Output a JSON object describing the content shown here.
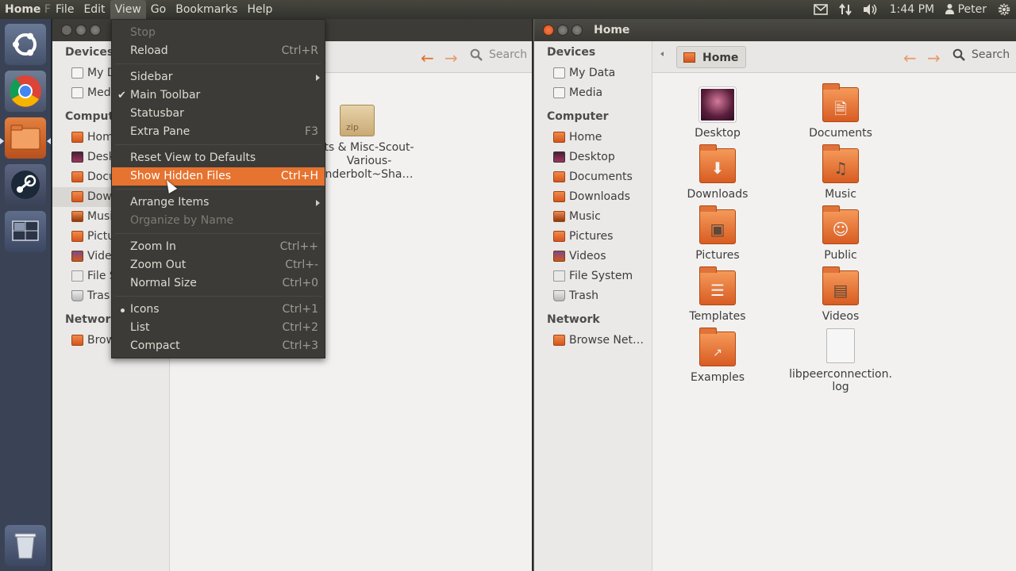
{
  "top_panel": {
    "app_title": "Home",
    "app_title_suffix": " F",
    "menus": [
      "File",
      "Edit",
      "View",
      "Go",
      "Bookmarks",
      "Help"
    ],
    "clock": "1:44 PM",
    "user": "Peter"
  },
  "launcher": {
    "items": [
      "Ubuntu",
      "Chromium",
      "Files",
      "Steam",
      "Workspace Switcher",
      "Trash"
    ]
  },
  "view_menu": {
    "items": [
      {
        "label": "Stop",
        "accel": ""
      },
      {
        "label": "Reload",
        "accel": "Ctrl+R"
      },
      {
        "label": "Sidebar",
        "accel": ""
      },
      {
        "label": "Main Toolbar",
        "accel": ""
      },
      {
        "label": "Statusbar",
        "accel": ""
      },
      {
        "label": "Extra Pane",
        "accel": "F3"
      },
      {
        "label": "Reset View to Defaults",
        "accel": ""
      },
      {
        "label": "Show Hidden Files",
        "accel": "Ctrl+H"
      },
      {
        "label": "Arrange Items",
        "accel": ""
      },
      {
        "label": "Organize by Name",
        "accel": ""
      },
      {
        "label": "Zoom In",
        "accel": "Ctrl++"
      },
      {
        "label": "Zoom Out",
        "accel": "Ctrl+-"
      },
      {
        "label": "Normal Size",
        "accel": "Ctrl+0"
      },
      {
        "label": "Icons",
        "accel": "Ctrl+1"
      },
      {
        "label": "List",
        "accel": "Ctrl+2"
      },
      {
        "label": "Compact",
        "accel": "Ctrl+3"
      }
    ]
  },
  "left_window": {
    "sidebar": {
      "devices_heading": "Devices",
      "devices": [
        "My D",
        "Medi"
      ],
      "computer_heading": "Comput",
      "computer": [
        "Home",
        "Desk",
        "Docu",
        "Dow",
        "Musi",
        "Pictu",
        "Vide",
        "File S",
        "Tras"
      ],
      "network_heading": "Network",
      "network": [
        "Brow"
      ]
    },
    "search_label": "Search",
    "zip_label": "zip",
    "zip_name": [
      "ts & Misc-Scout-",
      "Various-",
      "nderbolt~Sha…"
    ]
  },
  "right_window": {
    "title": "Home",
    "breadcrumb": "Home",
    "search_label": "Search",
    "sidebar": {
      "devices_heading": "Devices",
      "devices": [
        "My Data",
        "Media"
      ],
      "computer_heading": "Computer",
      "computer": [
        "Home",
        "Desktop",
        "Documents",
        "Downloads",
        "Music",
        "Pictures",
        "Videos",
        "File System",
        "Trash"
      ],
      "network_heading": "Network",
      "network": [
        "Browse Net…"
      ]
    },
    "files": [
      {
        "name": "Desktop"
      },
      {
        "name": "Documents"
      },
      {
        "name": "Downloads"
      },
      {
        "name": "Music"
      },
      {
        "name": "Pictures"
      },
      {
        "name": "Public"
      },
      {
        "name": "Templates"
      },
      {
        "name": "Videos"
      },
      {
        "name": "Examples"
      },
      {
        "name": "libpeerconnection.",
        "name2": "log"
      }
    ]
  }
}
